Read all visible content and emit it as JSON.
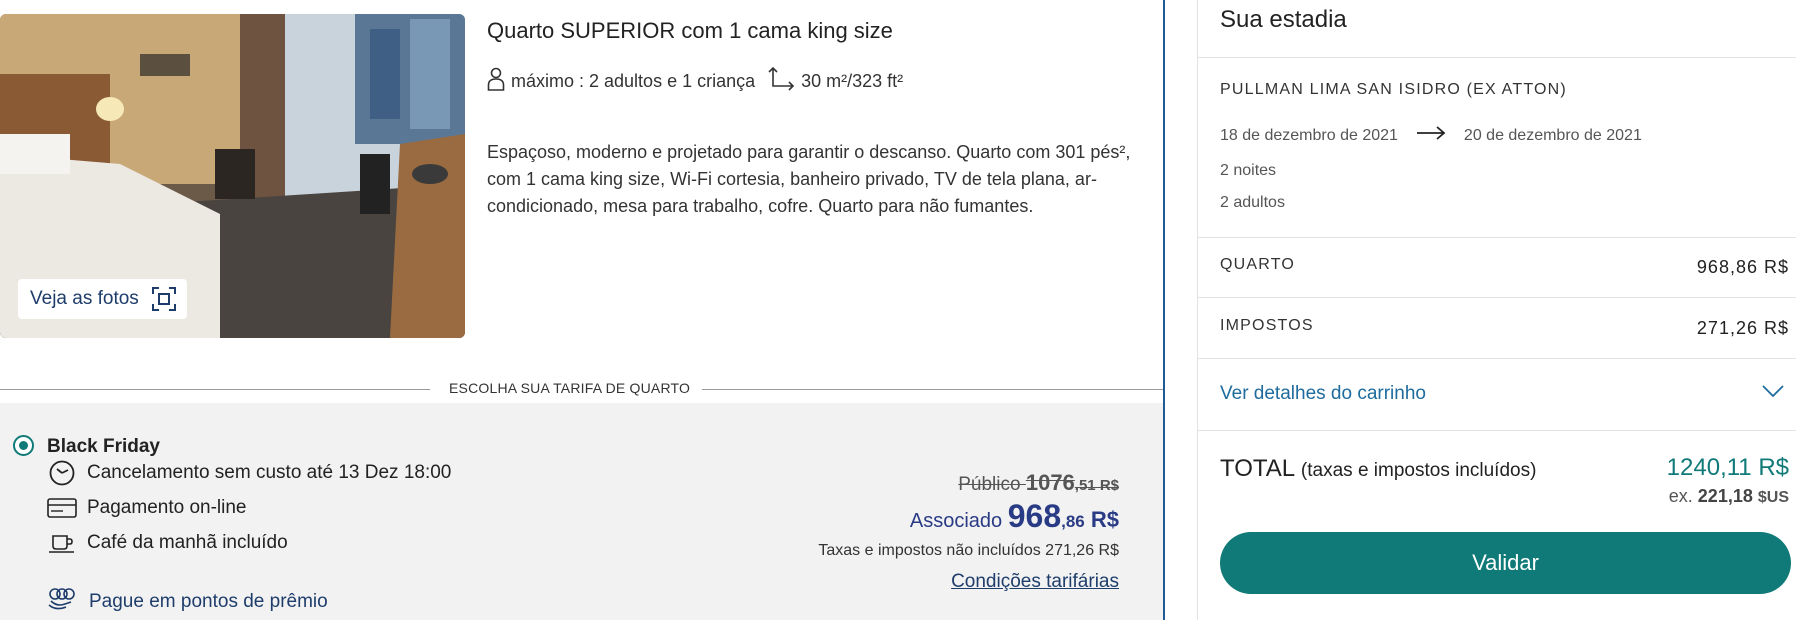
{
  "room": {
    "title": "Quarto SUPERIOR com 1 cama king size",
    "capacity": "máximo : 2 adultos e 1 criança",
    "size": "30 m²/323 ft²",
    "description": "Espaçoso, moderno e projetado para garantir o descanso. Quarto com 301 pés², com 1 cama king size, Wi-Fi cortesia, banheiro privado, TV de tela plana, ar-condicionado, mesa para trabalho, cofre. Quarto para não fumantes.",
    "photos_button": "Veja as fotos"
  },
  "rate_section": {
    "heading": "ESCOLHA SUA TARIFA DE QUARTO"
  },
  "rate": {
    "name": "Black Friday",
    "features": [
      {
        "icon": "clock-icon",
        "label": "Cancelamento sem custo até 13 Dez 18:00"
      },
      {
        "icon": "credit-card-icon",
        "label": "Pagamento on-line"
      },
      {
        "icon": "coffee-cup-icon",
        "label": "Café da manhã incluído"
      }
    ],
    "points_link": "Pague em pontos de prêmio",
    "public_label": "Público",
    "public_int": "1076",
    "public_dec": ",51 R$",
    "member_label": "Associado",
    "member_int": "968",
    "member_dec": ",86",
    "member_cur": " R$",
    "taxes_note": "Taxas e impostos não incluídos 271,26 R$",
    "conditions_link": "Condições tarifárias"
  },
  "summary": {
    "title": "Sua estadia",
    "hotel": "PULLMAN LIMA SAN ISIDRO (EX ATTON)",
    "checkin": "18 de dezembro de 2021",
    "checkout": "20 de dezembro de 2021",
    "nights": "2 noites",
    "adults": "2 adultos",
    "room_label": "QUARTO",
    "room_value": "968,86 R$",
    "taxes_label": "IMPOSTOS",
    "taxes_value": "271,26 R$",
    "cart_link": "Ver detalhes do carrinho",
    "total_label": "TOTAL",
    "total_sub": "(taxas e impostos incluídos)",
    "total_value": "1240,11 R$",
    "usd_prefix": "ex.",
    "usd_value": "221,18",
    "usd_cur": "$US",
    "validate_button": "Validar"
  },
  "colors": {
    "accent": "#0f7a77",
    "link": "#1e3d6b",
    "member_price": "#2a3b86",
    "divider_blue": "#1f5a94"
  }
}
